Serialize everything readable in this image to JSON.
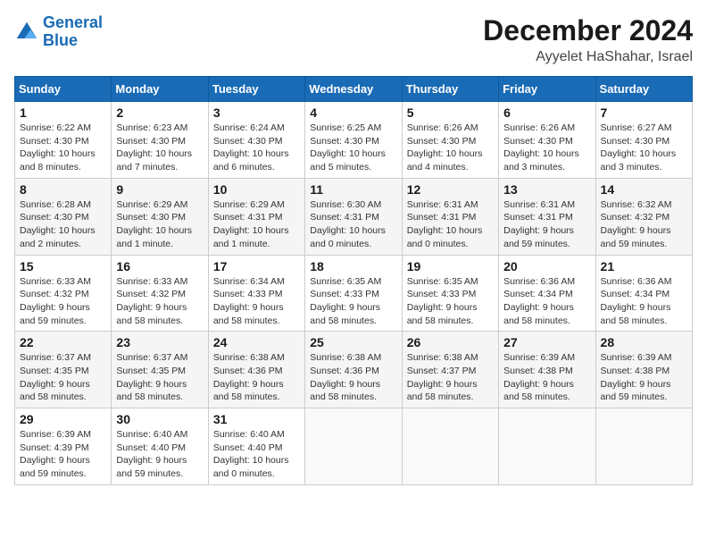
{
  "header": {
    "logo_general": "General",
    "logo_blue": "Blue",
    "title": "December 2024",
    "subtitle": "Ayyelet HaShahar, Israel"
  },
  "weekdays": [
    "Sunday",
    "Monday",
    "Tuesday",
    "Wednesday",
    "Thursday",
    "Friday",
    "Saturday"
  ],
  "weeks": [
    [
      {
        "day": "1",
        "sunrise": "6:22 AM",
        "sunset": "4:30 PM",
        "daylight": "10 hours and 8 minutes."
      },
      {
        "day": "2",
        "sunrise": "6:23 AM",
        "sunset": "4:30 PM",
        "daylight": "10 hours and 7 minutes."
      },
      {
        "day": "3",
        "sunrise": "6:24 AM",
        "sunset": "4:30 PM",
        "daylight": "10 hours and 6 minutes."
      },
      {
        "day": "4",
        "sunrise": "6:25 AM",
        "sunset": "4:30 PM",
        "daylight": "10 hours and 5 minutes."
      },
      {
        "day": "5",
        "sunrise": "6:26 AM",
        "sunset": "4:30 PM",
        "daylight": "10 hours and 4 minutes."
      },
      {
        "day": "6",
        "sunrise": "6:26 AM",
        "sunset": "4:30 PM",
        "daylight": "10 hours and 3 minutes."
      },
      {
        "day": "7",
        "sunrise": "6:27 AM",
        "sunset": "4:30 PM",
        "daylight": "10 hours and 3 minutes."
      }
    ],
    [
      {
        "day": "8",
        "sunrise": "6:28 AM",
        "sunset": "4:30 PM",
        "daylight": "10 hours and 2 minutes."
      },
      {
        "day": "9",
        "sunrise": "6:29 AM",
        "sunset": "4:30 PM",
        "daylight": "10 hours and 1 minute."
      },
      {
        "day": "10",
        "sunrise": "6:29 AM",
        "sunset": "4:31 PM",
        "daylight": "10 hours and 1 minute."
      },
      {
        "day": "11",
        "sunrise": "6:30 AM",
        "sunset": "4:31 PM",
        "daylight": "10 hours and 0 minutes."
      },
      {
        "day": "12",
        "sunrise": "6:31 AM",
        "sunset": "4:31 PM",
        "daylight": "10 hours and 0 minutes."
      },
      {
        "day": "13",
        "sunrise": "6:31 AM",
        "sunset": "4:31 PM",
        "daylight": "9 hours and 59 minutes."
      },
      {
        "day": "14",
        "sunrise": "6:32 AM",
        "sunset": "4:32 PM",
        "daylight": "9 hours and 59 minutes."
      }
    ],
    [
      {
        "day": "15",
        "sunrise": "6:33 AM",
        "sunset": "4:32 PM",
        "daylight": "9 hours and 59 minutes."
      },
      {
        "day": "16",
        "sunrise": "6:33 AM",
        "sunset": "4:32 PM",
        "daylight": "9 hours and 58 minutes."
      },
      {
        "day": "17",
        "sunrise": "6:34 AM",
        "sunset": "4:33 PM",
        "daylight": "9 hours and 58 minutes."
      },
      {
        "day": "18",
        "sunrise": "6:35 AM",
        "sunset": "4:33 PM",
        "daylight": "9 hours and 58 minutes."
      },
      {
        "day": "19",
        "sunrise": "6:35 AM",
        "sunset": "4:33 PM",
        "daylight": "9 hours and 58 minutes."
      },
      {
        "day": "20",
        "sunrise": "6:36 AM",
        "sunset": "4:34 PM",
        "daylight": "9 hours and 58 minutes."
      },
      {
        "day": "21",
        "sunrise": "6:36 AM",
        "sunset": "4:34 PM",
        "daylight": "9 hours and 58 minutes."
      }
    ],
    [
      {
        "day": "22",
        "sunrise": "6:37 AM",
        "sunset": "4:35 PM",
        "daylight": "9 hours and 58 minutes."
      },
      {
        "day": "23",
        "sunrise": "6:37 AM",
        "sunset": "4:35 PM",
        "daylight": "9 hours and 58 minutes."
      },
      {
        "day": "24",
        "sunrise": "6:38 AM",
        "sunset": "4:36 PM",
        "daylight": "9 hours and 58 minutes."
      },
      {
        "day": "25",
        "sunrise": "6:38 AM",
        "sunset": "4:36 PM",
        "daylight": "9 hours and 58 minutes."
      },
      {
        "day": "26",
        "sunrise": "6:38 AM",
        "sunset": "4:37 PM",
        "daylight": "9 hours and 58 minutes."
      },
      {
        "day": "27",
        "sunrise": "6:39 AM",
        "sunset": "4:38 PM",
        "daylight": "9 hours and 58 minutes."
      },
      {
        "day": "28",
        "sunrise": "6:39 AM",
        "sunset": "4:38 PM",
        "daylight": "9 hours and 59 minutes."
      }
    ],
    [
      {
        "day": "29",
        "sunrise": "6:39 AM",
        "sunset": "4:39 PM",
        "daylight": "9 hours and 59 minutes."
      },
      {
        "day": "30",
        "sunrise": "6:40 AM",
        "sunset": "4:40 PM",
        "daylight": "9 hours and 59 minutes."
      },
      {
        "day": "31",
        "sunrise": "6:40 AM",
        "sunset": "4:40 PM",
        "daylight": "10 hours and 0 minutes."
      },
      null,
      null,
      null,
      null
    ]
  ]
}
